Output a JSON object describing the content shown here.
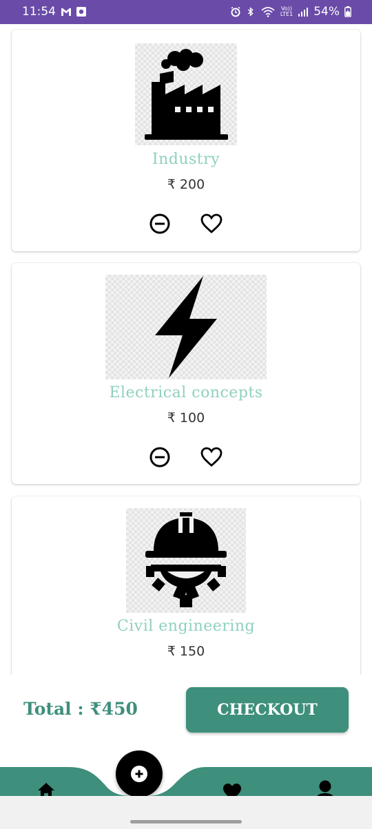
{
  "status_bar": {
    "time": "11:54",
    "battery": "54%",
    "icons": [
      "gmail-icon",
      "app-icon",
      "alarm-icon",
      "bluetooth-icon",
      "wifi-icon",
      "lte-icon",
      "signal-icon",
      "battery-icon"
    ],
    "network_label_top": "Vo))",
    "network_label_bottom": "LTE1"
  },
  "products": [
    {
      "title": "Industry",
      "price": "₹ 200",
      "icon": "factory-icon"
    },
    {
      "title": "Electrical concepts",
      "price": "₹ 100",
      "icon": "lightning-icon"
    },
    {
      "title": "Civil engineering",
      "price": "₹ 150",
      "icon": "helmet-gear-icon"
    }
  ],
  "actions": {
    "remove_icon": "minus-circle-icon",
    "favorite_icon": "heart-outline-icon"
  },
  "footer": {
    "total": "Total : ₹450",
    "checkout": "CHECKOUT"
  },
  "nav": {
    "items": [
      "home-icon",
      "add-icon",
      "heart-icon",
      "profile-icon"
    ]
  },
  "colors": {
    "accent": "#3e8f7c",
    "title": "#8fd0bf",
    "statusbar": "#6a4ba8"
  }
}
